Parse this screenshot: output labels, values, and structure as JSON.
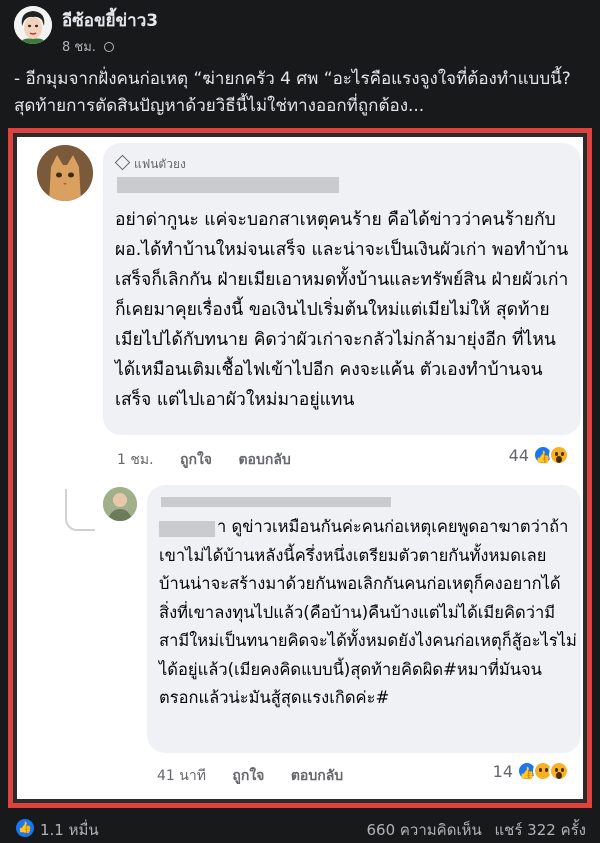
{
  "post": {
    "page_name": "อีซ้อขยี้ข่าว3",
    "time": "8 ชม.",
    "text": "- อีกมุมจากฝั่งคนก่อเหตุ “ฆ่ายกครัว 4 ศพ “อะไรคือแรงจูงใจที่ต้องทำแบบนี้? สุดท้ายการตัดสินปัญหาด้วยวิธีนี้ไม่ใช่ทางออกที่ถูกต้อง..."
  },
  "comment_1": {
    "badge": "แฟนตัวยง",
    "text": "อย่าด่ากูนะ แค่จะบอกสาเหตุคนร้าย คือได้ข่าวว่าคนร้ายกับ ผอ.ได้ทำบ้านใหม่จนเสร็จ และน่าจะเป็นเงินผัวเก่า พอทำบ้านเสร็จก็เลิกกัน ฝ่ายเมียเอาหมดทั้งบ้านและทรัพย์สิน ฝ่ายผัวเก่าก็เคยมาคุยเรื่องนี้ ขอเงินไปเริ่มต้นใหม่แต่เมียไม่ให้ สุดท้ายเมียไปได้กับทนาย คิดว่าผัวเก่าจะกลัวไม่กล้ามายุ่งอีก ที่ไหนได้เหมือนเติมเชื้อไฟเข้าไปอีก คงจะแค้น ตัวเองทำบ้านจนเสร็จ แต่ไปเอาผัวใหม่มาอยู่แทน",
    "time": "1 ชม.",
    "like_label": "ถูกใจ",
    "reply_label": "ตอบกลับ",
    "reaction_count": "44"
  },
  "comment_2": {
    "text_suffix": "า ดูข่าวเหมือนกันค่ะคนก่อเหตุเคยพูดอาฆาตว่าถ้าเขาไม่ได้บ้านหลังนี้ครึ่งหนึ่งเตรียมตัวตายกันทั้งหมดเลยบ้านน่าจะสร้างมาด้วยกันพอเลิกกันคนก่อเหตุก็คงอยากได้สิ่งที่เขาลงทุนไปแล้ว(คือบ้าน)คืนบ้างแต่ไม่ได้เมียคิดว่ามีสามีใหม่เป็นทนายคิดจะได้ทั้งหมดยังไงคนก่อเหตุก็สู้อะไรไม่ได้อยู่แล้ว(เมียคงคิดแบบนี้)สุดท้ายคิดผิด#หมาที่มันจนตรอกแล้วน่ะมันสู้สุดแรงเกิดค่ะ#",
    "time": "41 นาที",
    "like_label": "ถูกใจ",
    "reply_label": "ตอบกลับ",
    "reaction_count": "14"
  },
  "footer": {
    "reactions": "1.1 หมื่น",
    "comments": "660 ความคิดเห็น",
    "shares": "แชร์ 322 ครั้ง"
  },
  "icons": [
    "globe-icon",
    "diamond-icon",
    "like-icon",
    "wow-icon",
    "sad-icon"
  ],
  "colors": {
    "frame": "#e0413d",
    "like": "#1877f2",
    "background": "#18191a"
  }
}
